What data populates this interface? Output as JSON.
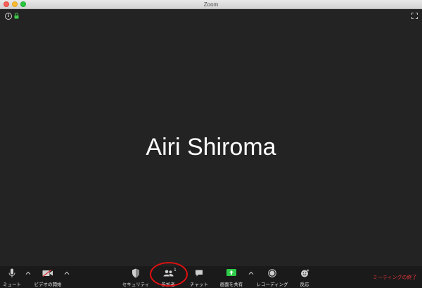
{
  "window": {
    "title": "Zoom"
  },
  "video": {
    "speaker_name": "Airi Shiroma"
  },
  "toolbar": {
    "mute_label": "ミュート",
    "video_label": "ビデオの開始",
    "security_label": "セキュリティ",
    "participants_label": "参加者",
    "participants_count": "1",
    "chat_label": "チャット",
    "share_label": "画面を共有",
    "record_label": "レコーディング",
    "reactions_label": "反応",
    "end_label": "ミーティングの終了"
  },
  "colors": {
    "background": "#232323",
    "end_red": "#e0363c",
    "share_green": "#2dcd49",
    "highlight_ring": "#e01010"
  }
}
